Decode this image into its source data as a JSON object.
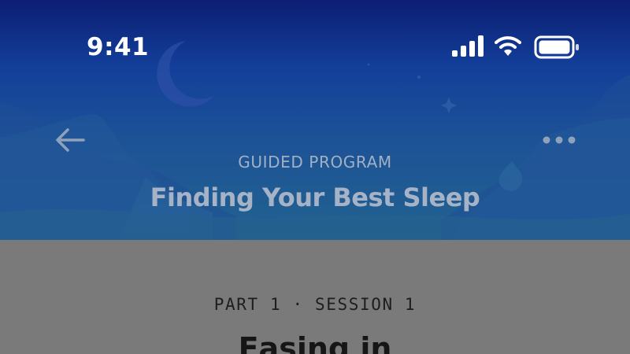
{
  "status_bar": {
    "time": "9:41",
    "icons": [
      "signal-icon",
      "wifi-icon",
      "battery-icon"
    ]
  },
  "nav": {
    "back_icon": "arrow-left-icon",
    "more_icon": "ellipsis-icon"
  },
  "header": {
    "eyebrow": "GUIDED PROGRAM",
    "title": "Finding Your Best Sleep",
    "decorations": [
      "crescent-moon",
      "sparkle-stars",
      "misty-hills"
    ]
  },
  "session": {
    "meta": "PART 1 · SESSION 1",
    "title": "Easing in"
  },
  "colors": {
    "sky_top": "#0c1e73",
    "sky_bottom": "#22628f",
    "content_background": "#7a7a7a",
    "header_text": "#a6b3c7"
  }
}
